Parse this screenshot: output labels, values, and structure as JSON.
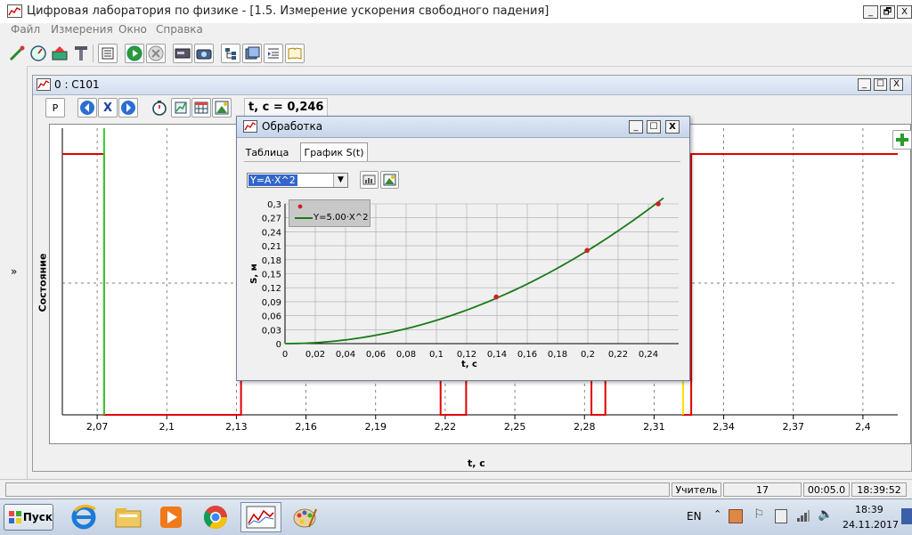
{
  "window": {
    "title": "Цифровая лаборатория по физике - [1.5. Измерение ускорения свободного падения]",
    "controls": {
      "minimize": "_",
      "restore": "🗗",
      "close": "X"
    }
  },
  "menu": [
    "Файл",
    "Измерения",
    "Окно",
    "Справка"
  ],
  "side_expander": "»",
  "child_window": {
    "title": "0 : C101",
    "p_button": "P",
    "x_button": "X",
    "readout": "t, c = 0,246",
    "add_button": "+"
  },
  "main_chart_data": {
    "type": "line",
    "ylabel": "Состояние",
    "xlabel": "t, c",
    "x_ticks": [
      "2,07",
      "2,1",
      "2,13",
      "2,16",
      "2,19",
      "2,22",
      "2,25",
      "2,28",
      "2,31",
      "2,34",
      "2,37",
      "2,4"
    ],
    "xlim": [
      2.055,
      2.415
    ],
    "series": [
      {
        "color": "#e00000",
        "x": [
          2.055,
          2.073,
          2.073,
          2.132,
          2.132,
          2.218,
          2.218,
          2.229,
          2.229,
          2.283,
          2.283,
          2.289,
          2.289,
          2.3225,
          2.3225,
          2.326,
          2.326,
          2.415
        ],
        "y": [
          1,
          1,
          0,
          0,
          1,
          1,
          0,
          0,
          1,
          1,
          0,
          0,
          1,
          1,
          0,
          0,
          1,
          1
        ]
      }
    ],
    "cursor_green_x": 2.073,
    "cursor_yellow_x": 2.3225
  },
  "dialog": {
    "title": "Обработка",
    "tabs": [
      "Таблица",
      "График S(t)"
    ],
    "active_tab": "График S(t)",
    "formula_select": "Y=A·X^2",
    "legend_fit_label": "Y=5.00·X^2",
    "controls": {
      "minimize": "_",
      "maximize": "☐",
      "close": "X"
    }
  },
  "chart_data": {
    "type": "scatter",
    "xlabel": "t, c",
    "ylabel": "S, м",
    "xlim": [
      0,
      0.26
    ],
    "ylim": [
      0,
      0.3
    ],
    "x_ticks": [
      "0",
      "0,02",
      "0,04",
      "0,06",
      "0,08",
      "0,1",
      "0,12",
      "0,14",
      "0,16",
      "0,18",
      "0,2",
      "0,22",
      "0,24"
    ],
    "y_ticks": [
      "0",
      "0,03",
      "0,06",
      "0,09",
      "0,12",
      "0,15",
      "0,18",
      "0,21",
      "0,24",
      "0,27",
      "0,3"
    ],
    "grid": true,
    "legend_position": "top-left",
    "series": [
      {
        "kind": "points",
        "color": "#cc2222",
        "x": [
          0.1395,
          0.1995,
          0.2465
        ],
        "y": [
          0.1,
          0.2,
          0.3
        ]
      },
      {
        "name": "Y=5.00·X^2",
        "kind": "fit",
        "color": "#1a7a1a",
        "a": 5.0,
        "x_range": [
          0,
          0.25
        ]
      }
    ]
  },
  "status": {
    "user": "Учитель",
    "count": "17",
    "elapsed": "00:05.0",
    "clock": "18:39:52"
  },
  "taskbar": {
    "start": "Пуск",
    "lang": "EN",
    "time": "18:39",
    "date": "24.11.2017"
  }
}
